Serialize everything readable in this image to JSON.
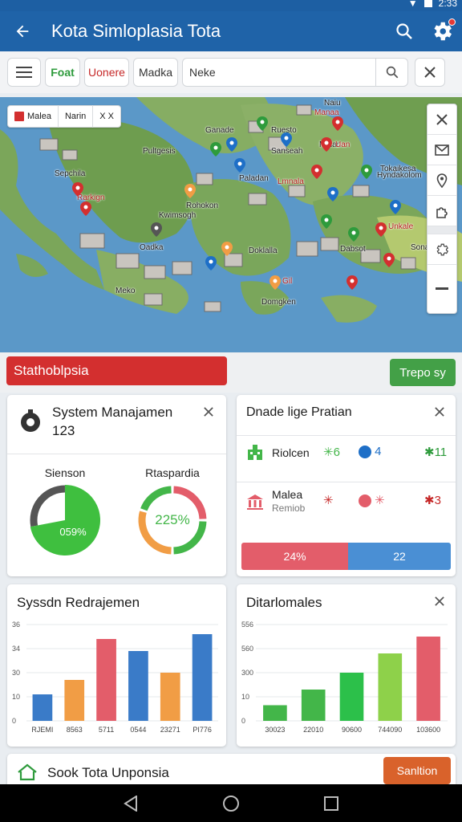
{
  "status_bar": {
    "time": "2:33"
  },
  "app_bar": {
    "title": "Kota Simloplasia Tota"
  },
  "filter_bar": {
    "chips": [
      "Foat",
      "Uonere",
      "Madka"
    ],
    "search_value": "Neke",
    "search_placeholder": "Neke"
  },
  "map": {
    "legend": [
      "Malea",
      "Narin",
      "X X"
    ],
    "labels": [
      {
        "text": "Naiu",
        "color": "dark"
      },
      {
        "text": "Manaa",
        "color": "red"
      },
      {
        "text": "Ganade",
        "color": "dark"
      },
      {
        "text": "Ruesto",
        "color": "dark"
      },
      {
        "text": "Pultgesis",
        "color": "dark"
      },
      {
        "text": "Malan",
        "color": "dark"
      },
      {
        "text": "Sanseah",
        "color": "dark"
      },
      {
        "text": "Uan",
        "color": "red"
      },
      {
        "text": "Sepchila",
        "color": "dark"
      },
      {
        "text": "Paladan",
        "color": "dark"
      },
      {
        "text": "Lmnala",
        "color": "red"
      },
      {
        "text": "Tokaikesa",
        "color": "dark"
      },
      {
        "text": "Hyndakolom",
        "color": "dark"
      },
      {
        "text": "Rarkign",
        "color": "red"
      },
      {
        "text": "Rohokon",
        "color": "dark"
      },
      {
        "text": "Kwimsogh",
        "color": "dark"
      },
      {
        "text": "Oadka",
        "color": "dark"
      },
      {
        "text": "Doklalla",
        "color": "dark"
      },
      {
        "text": "Dabsot",
        "color": "dark"
      },
      {
        "text": "Sonatsek",
        "color": "dark"
      },
      {
        "text": "Unkale",
        "color": "red"
      },
      {
        "text": "Meko",
        "color": "dark"
      },
      {
        "text": "Gil",
        "color": "red"
      },
      {
        "text": "Domgken",
        "color": "dark"
      }
    ]
  },
  "strip": {
    "red_label": "Stathoblpsia",
    "green_button": "Trepo sy"
  },
  "cards": {
    "system": {
      "title": "System Manajamen",
      "count": "123",
      "donut1": {
        "label": "Sienson",
        "value_text": "059%",
        "fraction": 0.72,
        "fill": "#3fbf3f",
        "rest": "#555555"
      },
      "donut2": {
        "label": "Rtaspardia",
        "value_text": "225%",
        "segments": [
          {
            "fraction": 0.25,
            "color": "#e35d6a"
          },
          {
            "fraction": 0.25,
            "color": "#43b649"
          },
          {
            "fraction": 0.3,
            "color": "#f19d45"
          },
          {
            "fraction": 0.2,
            "color": "#43b649"
          }
        ]
      }
    },
    "prutan": {
      "title": "Dnade lige Pratian",
      "rows": [
        {
          "name": "Riolcen",
          "sub": "",
          "v1": "6",
          "v2": "4",
          "v3": "11"
        },
        {
          "name": "Malea",
          "sub": "Remiob",
          "v1": "",
          "v2": "",
          "v3": "3"
        }
      ],
      "split": {
        "left": "24%",
        "right": "22",
        "left_fraction": 0.51
      }
    },
    "bar1": {
      "title": "Syssdn Redrajemen"
    },
    "bar2": {
      "title": "Ditarlomales"
    }
  },
  "chart_data": [
    {
      "type": "bar",
      "title": "Syssdn Redrajemen",
      "categories": [
        "RJEMI",
        "8563",
        "5711",
        "0544",
        "23271",
        "PI776"
      ],
      "values": [
        11,
        17,
        34,
        29,
        20,
        36
      ],
      "colors": [
        "#3a7bc8",
        "#f19d45",
        "#e35d6a",
        "#3a7bc8",
        "#f19d45",
        "#3a7bc8"
      ],
      "yticks": [
        "0",
        "10",
        "30",
        "34",
        "36"
      ],
      "ylim": [
        0,
        40
      ]
    },
    {
      "type": "bar",
      "title": "Ditarlomales",
      "categories": [
        "30023",
        "22010",
        "90600",
        "744090",
        "103600"
      ],
      "values": [
        65,
        130,
        200,
        280,
        350
      ],
      "colors": [
        "#43b649",
        "#43b649",
        "#2cc04a",
        "#8ed14a",
        "#e35d6a"
      ],
      "yticks": [
        "0",
        "10",
        "300",
        "560",
        "556"
      ],
      "ylim": [
        0,
        400
      ]
    }
  ],
  "bottom": {
    "title": "Sook Tota Unponsia",
    "button": "Sanltion"
  }
}
